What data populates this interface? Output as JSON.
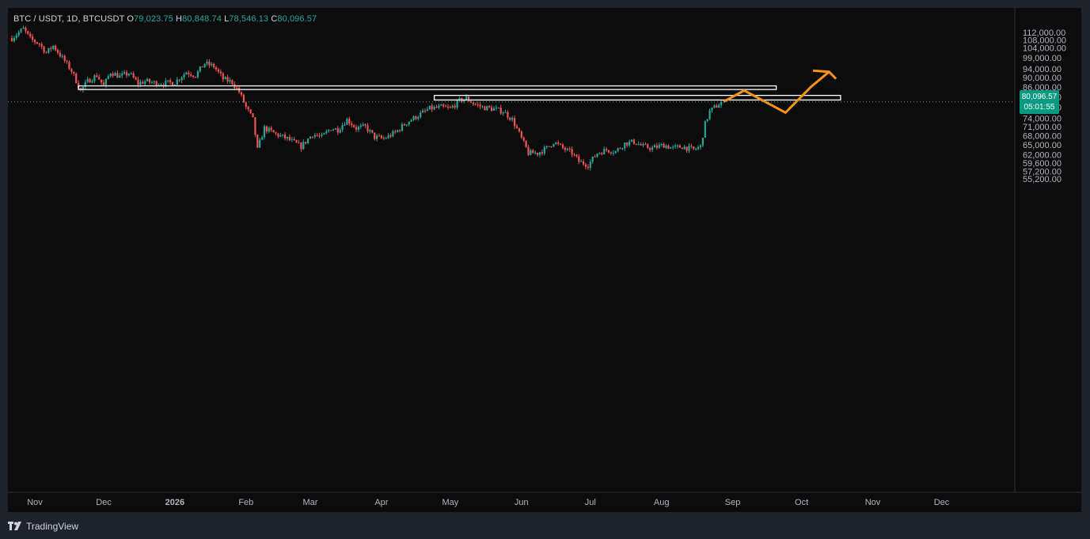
{
  "legend": {
    "symbol": "BTC / USDT, 1D, BTCUSDT",
    "o_label": "O",
    "o_value": "79,023.75",
    "h_label": "H",
    "h_value": "80,848.74",
    "l_label": "L",
    "l_value": "78,546.13",
    "c_label": "C",
    "c_value": "80,096.57"
  },
  "price_tag": {
    "price": "80,096.57",
    "countdown": "05:01:55"
  },
  "footer": {
    "brand": "TradingView",
    "logo": "tradingview-logo-icon"
  },
  "colors": {
    "up": "#26a69a",
    "down": "#ef5350",
    "projection": "#f7931a",
    "zone": "#ffffff",
    "background": "#0c0c0c"
  },
  "chart_data": {
    "type": "candlestick",
    "symbol": "BTCUSDT",
    "interval": "1D",
    "y_ticks": [
      112000,
      108000,
      104000,
      99000,
      94000,
      90000,
      86000,
      82000,
      78000,
      74000,
      71000,
      68000,
      65000,
      62000,
      59600,
      57200,
      55200
    ],
    "y_tick_labels": [
      "112,000.00",
      "108,000.00",
      "104,000.00",
      "99,000.00",
      "94,000.00",
      "90,000.00",
      "86,000.00",
      "82,000.00",
      "78,000.00",
      "74,000.00",
      "71,000.00",
      "68,000.00",
      "65,000.00",
      "62,000.00",
      "59,600.00",
      "57,200.00",
      "55,200.00"
    ],
    "y_scale": "log",
    "x_ticks": [
      "Nov",
      "Dec",
      "2026",
      "Feb",
      "Mar",
      "Apr",
      "May",
      "Jun",
      "Jul",
      "Aug",
      "Sep",
      "Oct",
      "Nov",
      "Dec"
    ],
    "x_tick_bold": [
      false,
      false,
      true,
      false,
      false,
      false,
      false,
      false,
      false,
      false,
      false,
      false,
      false,
      false
    ],
    "x_range": [
      "2025-10-22",
      "2026-12-31"
    ],
    "last_price": 80096.57,
    "close_anchors": [
      [
        "2025-10-22",
        109000
      ],
      [
        "2025-10-27",
        114000
      ],
      [
        "2025-10-30",
        108500
      ],
      [
        "2025-11-03",
        106000
      ],
      [
        "2025-11-06",
        101500
      ],
      [
        "2025-11-09",
        105000
      ],
      [
        "2025-11-13",
        99000
      ],
      [
        "2025-11-17",
        93000
      ],
      [
        "2025-11-21",
        84500
      ],
      [
        "2025-11-24",
        88500
      ],
      [
        "2025-11-28",
        91000
      ],
      [
        "2025-12-01",
        86500
      ],
      [
        "2025-12-04",
        92500
      ],
      [
        "2025-12-08",
        90500
      ],
      [
        "2025-12-12",
        92000
      ],
      [
        "2025-12-16",
        87500
      ],
      [
        "2025-12-19",
        88500
      ],
      [
        "2025-12-25",
        87500
      ],
      [
        "2026-01-01",
        88000
      ],
      [
        "2026-01-06",
        92500
      ],
      [
        "2026-01-10",
        91000
      ],
      [
        "2026-01-14",
        96500
      ],
      [
        "2026-01-18",
        95000
      ],
      [
        "2026-01-22",
        89500
      ],
      [
        "2026-01-26",
        88000
      ],
      [
        "2026-01-29",
        84000
      ],
      [
        "2026-02-01",
        78000
      ],
      [
        "2026-02-04",
        73500
      ],
      [
        "2026-02-06",
        63500
      ],
      [
        "2026-02-09",
        70500
      ],
      [
        "2026-02-14",
        68500
      ],
      [
        "2026-02-19",
        67000
      ],
      [
        "2026-02-25",
        64500
      ],
      [
        "2026-03-02",
        68500
      ],
      [
        "2026-03-06",
        67500
      ],
      [
        "2026-03-10",
        70500
      ],
      [
        "2026-03-13",
        70000
      ],
      [
        "2026-03-17",
        73500
      ],
      [
        "2026-03-21",
        70500
      ],
      [
        "2026-03-25",
        71000
      ],
      [
        "2026-03-29",
        67500
      ],
      [
        "2026-04-02",
        67000
      ],
      [
        "2026-04-07",
        69000
      ],
      [
        "2026-04-12",
        72500
      ],
      [
        "2026-04-16",
        74500
      ],
      [
        "2026-04-22",
        77500
      ],
      [
        "2026-04-27",
        78000
      ],
      [
        "2026-05-01",
        77500
      ],
      [
        "2026-05-05",
        80500
      ],
      [
        "2026-05-08",
        81500
      ],
      [
        "2026-05-11",
        79500
      ],
      [
        "2026-05-15",
        78000
      ],
      [
        "2026-05-19",
        77500
      ],
      [
        "2026-05-24",
        76500
      ],
      [
        "2026-05-28",
        73500
      ],
      [
        "2026-06-01",
        67000
      ],
      [
        "2026-06-04",
        62500
      ],
      [
        "2026-06-08",
        62500
      ],
      [
        "2026-06-12",
        64000
      ],
      [
        "2026-06-15",
        66000
      ],
      [
        "2026-06-19",
        64000
      ],
      [
        "2026-06-23",
        62500
      ],
      [
        "2026-06-26",
        60000
      ],
      [
        "2026-06-30",
        59000
      ],
      [
        "2026-07-04",
        62500
      ],
      [
        "2026-07-08",
        63500
      ],
      [
        "2026-07-12",
        63000
      ],
      [
        "2026-07-16",
        65500
      ],
      [
        "2026-07-20",
        66000
      ],
      [
        "2026-07-24",
        64500
      ],
      [
        "2026-07-28",
        64000
      ],
      [
        "2026-08-02",
        65000
      ],
      [
        "2026-08-06",
        64000
      ],
      [
        "2026-08-10",
        64500
      ],
      [
        "2026-08-15",
        63500
      ],
      [
        "2026-08-18",
        64500
      ],
      [
        "2026-08-20",
        72000
      ],
      [
        "2026-08-22",
        76500
      ],
      [
        "2026-08-25",
        78500
      ],
      [
        "2026-08-27",
        80096.57
      ]
    ],
    "zones": [
      {
        "x_start": "2025-11-20",
        "x_end": "2026-09-20",
        "y_low": 85000,
        "y_high": 86500
      },
      {
        "x_start": "2026-04-24",
        "x_end": "2026-10-18",
        "y_low": 80800,
        "y_high": 82600
      }
    ],
    "projection_path": [
      [
        "2026-08-28",
        80100
      ],
      [
        "2026-09-06",
        84600
      ],
      [
        "2026-09-24",
        76000
      ],
      [
        "2026-10-05",
        86000
      ],
      [
        "2026-10-13",
        92600
      ]
    ],
    "projection_arrowhead": [
      [
        "2026-10-06",
        93100
      ],
      [
        "2026-10-13",
        92600
      ],
      [
        "2026-10-16",
        89500
      ]
    ]
  }
}
